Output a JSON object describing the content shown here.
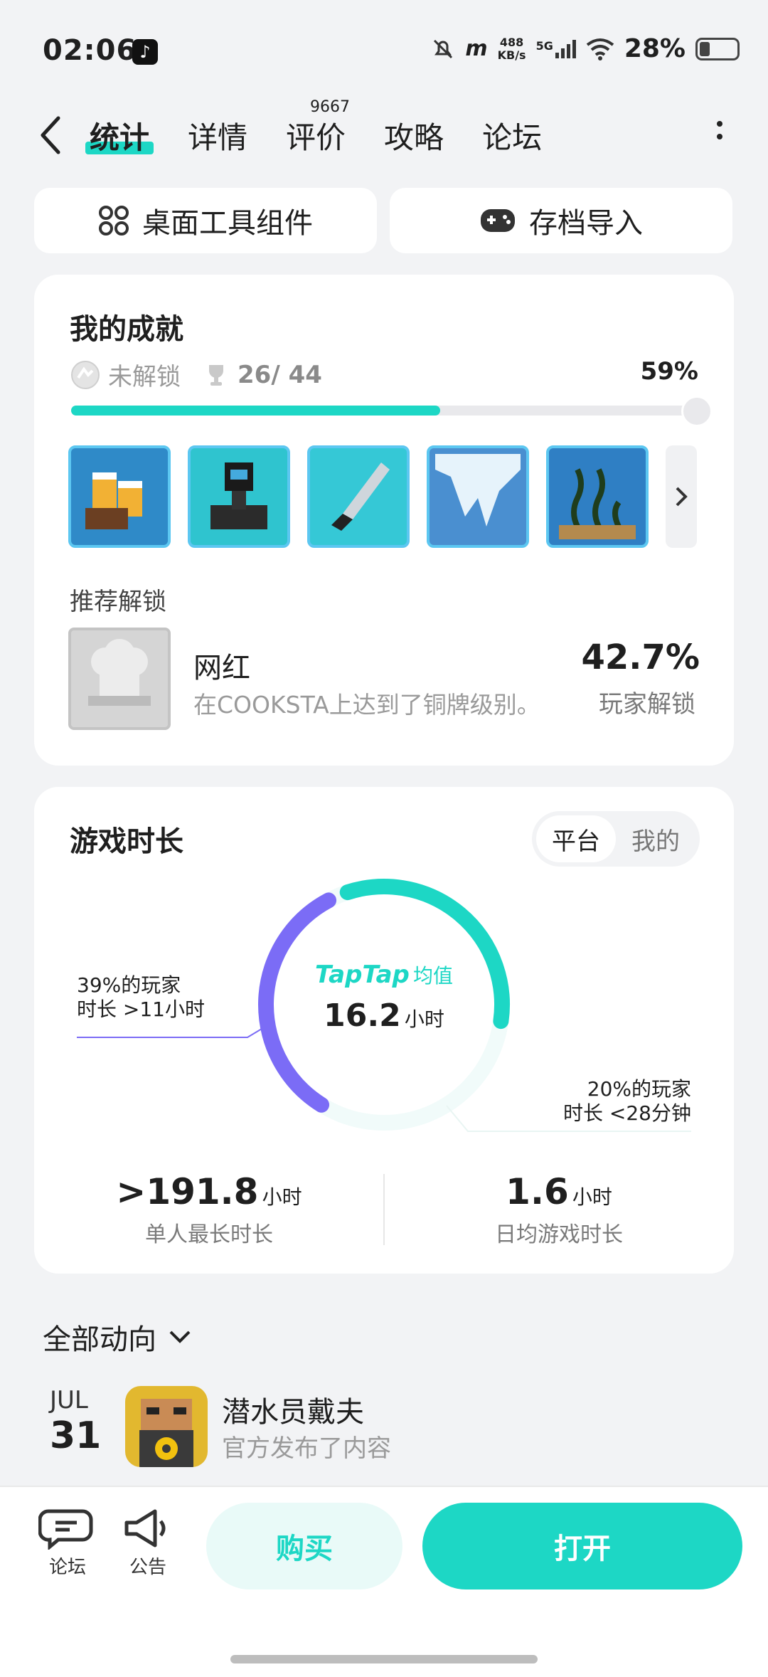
{
  "status_bar": {
    "time": "02:06",
    "net_speed_top": "488",
    "net_speed_bottom": "KB/s",
    "net_type": "5G",
    "battery": "28%",
    "battery_level": 0.28
  },
  "nav": {
    "tabs": [
      {
        "label": "统计",
        "active": true
      },
      {
        "label": "详情"
      },
      {
        "label": "评价",
        "badge": "9667"
      },
      {
        "label": "攻略"
      },
      {
        "label": "论坛"
      }
    ]
  },
  "quick_actions": {
    "widget_label": "桌面工具组件",
    "import_label": "存档导入"
  },
  "achievements": {
    "title": "我的成就",
    "locked_label": "未解锁",
    "progress_text": "26/ 44",
    "percent": "59%",
    "progress_fraction": 0.59,
    "recommend_title": "推荐解锁",
    "recommend": {
      "name": "网红",
      "desc": "在COOKSTA上达到了铜牌级别。",
      "rate": "42.7%",
      "rate_label": "玩家解锁"
    }
  },
  "playtime": {
    "title": "游戏时长",
    "toggle": [
      "平台",
      "我的"
    ],
    "brand": "TapTap",
    "avg_label": "均值",
    "avg_value": "16.2",
    "avg_unit": "小时",
    "left_note_line1": "39%的玩家",
    "left_note_line2": "时长 >11小时",
    "right_note_line1": "20%的玩家",
    "right_note_line2": "时长 <28分钟",
    "stats": [
      {
        "prefix": ">",
        "value": "191.8",
        "unit": "小时",
        "label": "单人最长时长"
      },
      {
        "prefix": "",
        "value": "1.6",
        "unit": "小时",
        "label": "日均游戏时长"
      }
    ],
    "colors": {
      "teal": "#1dd7c5",
      "purple": "#7b6cf6"
    }
  },
  "feed": {
    "filter_label": "全部动向",
    "items": [
      {
        "month": "JUL",
        "day": "31",
        "title": "潜水员戴夫",
        "subtitle": "官方发布了内容"
      }
    ]
  },
  "bottom_bar": {
    "forum_label": "论坛",
    "notice_label": "公告",
    "buy_label": "购买",
    "open_label": "打开"
  }
}
